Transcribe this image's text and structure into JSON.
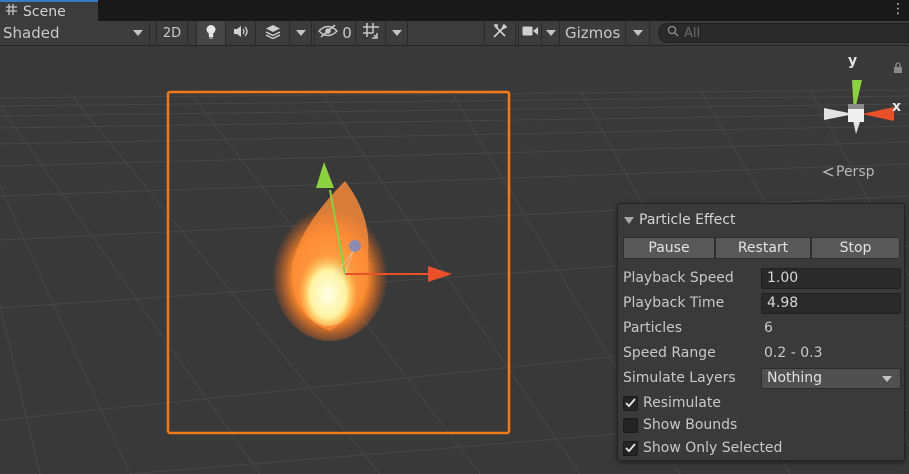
{
  "tab": {
    "title": "Scene",
    "icon": "grid-icon"
  },
  "toolbar": {
    "shading_mode": "Shaded",
    "mode_2d": "2D",
    "hidden_count": "0",
    "gizmos_label": "Gizmos",
    "search_placeholder": "All"
  },
  "orientation": {
    "y_label": "y",
    "x_label": "x",
    "projection": "Persp"
  },
  "particle_effect": {
    "title": "Particle Effect",
    "buttons": {
      "pause": "Pause",
      "restart": "Restart",
      "stop": "Stop"
    },
    "rows": {
      "playback_speed": {
        "label": "Playback Speed",
        "value": "1.00"
      },
      "playback_time": {
        "label": "Playback Time",
        "value": "4.98"
      },
      "particles": {
        "label": "Particles",
        "value": "6"
      },
      "speed_range": {
        "label": "Speed Range",
        "value": "0.2 - 0.3"
      },
      "simulate_layers": {
        "label": "Simulate Layers",
        "value": "Nothing"
      }
    },
    "checkboxes": {
      "resimulate": {
        "label": "Resimulate",
        "checked": true
      },
      "show_bounds": {
        "label": "Show Bounds",
        "checked": false
      },
      "show_only_selected": {
        "label": "Show Only Selected",
        "checked": true
      }
    }
  },
  "colors": {
    "selection_outline": "#f07a1a",
    "axis_x": "#e8502a",
    "axis_y": "#8bd140",
    "accent": "#3a79bb"
  }
}
